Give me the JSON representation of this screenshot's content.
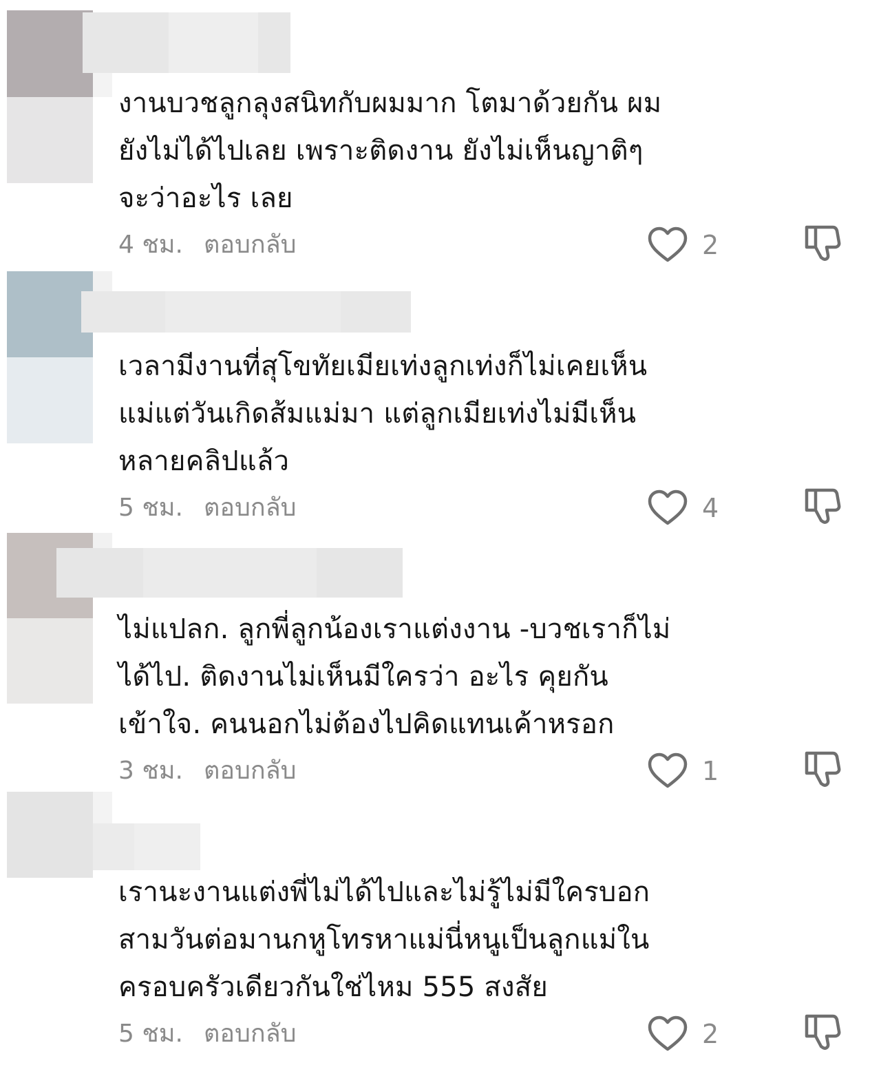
{
  "comments": [
    {
      "lines": [
        "งานบวชลูกลุงสนิทกับผมมาก โตมาด้วยกัน ผม",
        "ยังไม่ได้ไปเลย เพราะติดงาน ยังไม่เห็นญาติๆ",
        "จะว่าอะไร เลย"
      ],
      "time": "4 ชม.",
      "reply": "ตอบกลับ",
      "likes": "2",
      "avatar_colors": [
        "#b3adaf",
        "#e6e5e6"
      ]
    },
    {
      "lines": [
        "เวลามีงานที่สุโขทัยเมียเท่งลูกเท่งก็ไม่เคยเห็น",
        "แม่แต่วันเกิดส้มแม่มา แต่ลูกเมียเท่งไม่มีเห็น",
        "หลายคลิปแล้ว"
      ],
      "time": "5 ชม.",
      "reply": "ตอบกลับ",
      "likes": "4",
      "avatar_colors": [
        "#aebfc8",
        "#e6ebef"
      ]
    },
    {
      "lines": [
        "ไม่แปลก. ลูกพี่ลูกน้องเราแต่งงาน -บวชเราก็ไม่",
        "ได้ไป. ติดงานไม่เห็นมีใครว่า อะไร คุยกัน",
        "เข้าใจ. คนนอกไม่ต้องไปคิดแทนเค้าหรอก"
      ],
      "time": "3 ชม.",
      "reply": "ตอบกลับ",
      "likes": "1",
      "avatar_colors": [
        "#c6bfbd",
        "#e9e8e7"
      ]
    },
    {
      "lines": [
        "เรานะงานแต่งพี่ไม่ได้ไปและไม่รู้ไม่มีใครบอก",
        "สามวันต่อมานกหูโทรหาแม่นี่หนูเป็นลูกแม่ใน",
        "ครอบครัวเดียวกันใช่ไหม 555 สงสัย"
      ],
      "time": "5 ชม.",
      "reply": "ตอบกลับ",
      "likes": "2",
      "avatar_colors": [
        "#e4e4e4",
        "#ededed"
      ]
    }
  ],
  "icons": {
    "like": "heart-outline-icon",
    "dislike": "thumbs-down-outline-icon"
  },
  "colors": {
    "text": "#161616",
    "muted": "#8a8a8a",
    "icon": "#6f6f6f"
  }
}
